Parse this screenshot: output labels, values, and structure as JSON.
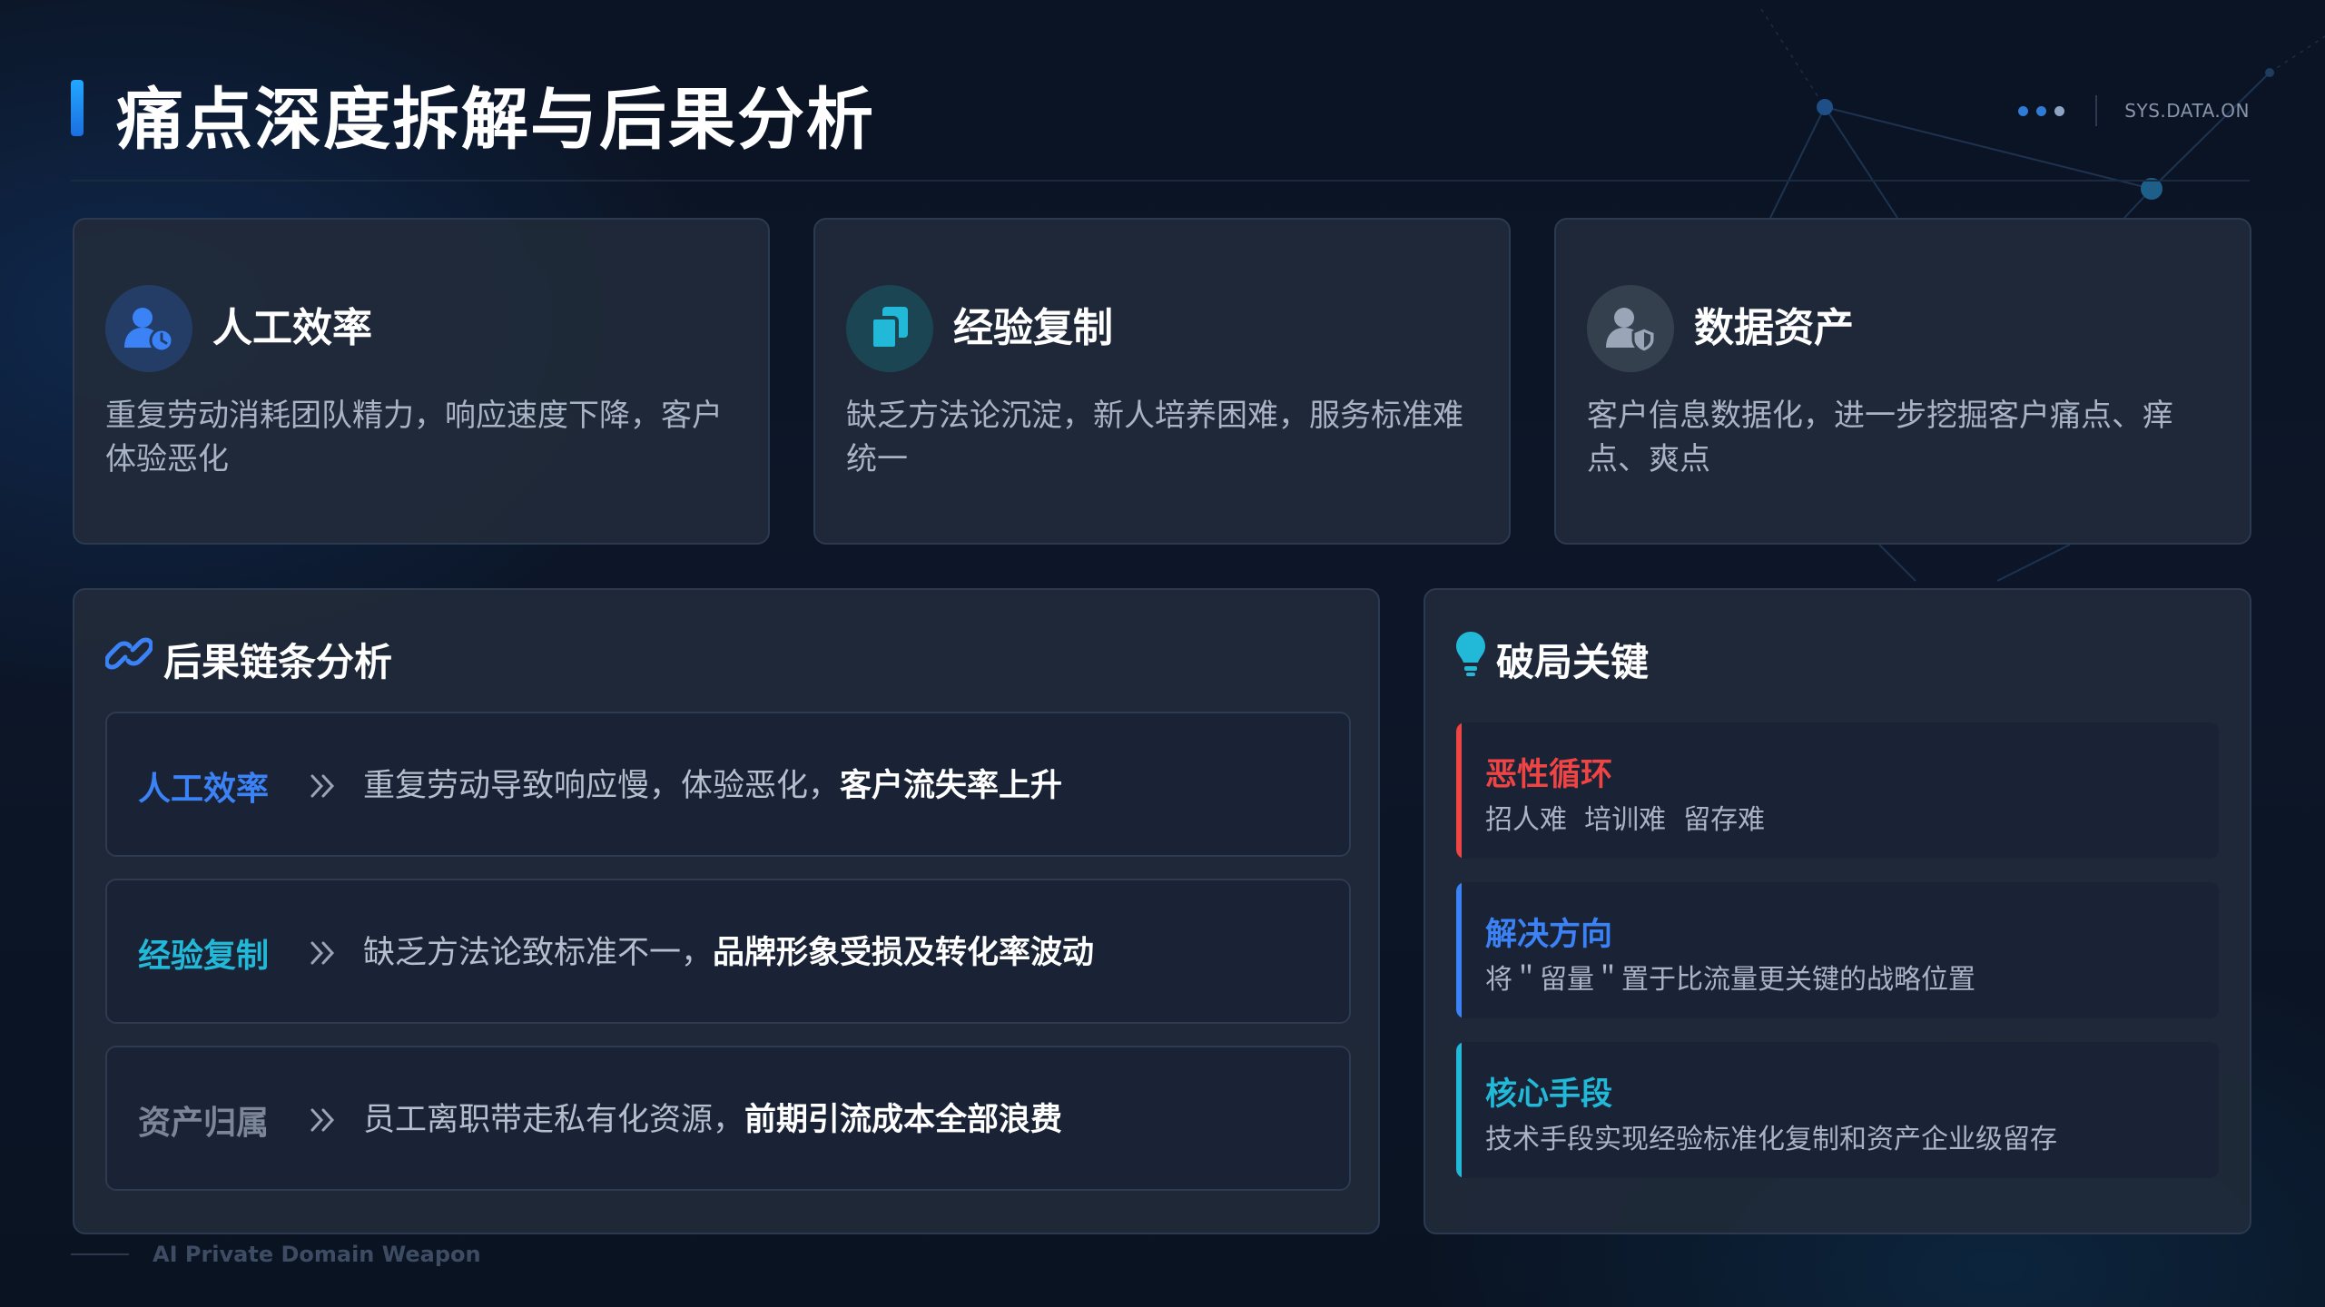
{
  "header": {
    "title": "痛点深度拆解与后果分析",
    "sys_label": "SYS.DATA.ON"
  },
  "pain_cards": [
    {
      "icon": "user-clock-icon",
      "title": "人工效率",
      "desc": "重复劳动消耗团队精力，响应速度下降，客户体验恶化",
      "accent": "#3b82f6"
    },
    {
      "icon": "copy-icon",
      "title": "经验复制",
      "desc": "缺乏方法论沉淀，新人培养困难，服务标准难统一",
      "accent": "#22b8d8"
    },
    {
      "icon": "user-shield-icon",
      "title": "数据资产",
      "desc": "客户信息数据化，进一步挖掘客户痛点、痒点、爽点",
      "accent": "#94a3b8"
    }
  ],
  "chain": {
    "title": "后果链条分析",
    "rows": [
      {
        "label": "人工效率",
        "label_color": "#3b82f6",
        "text": "重复劳动导致响应慢，体验恶化，",
        "emphasis": "客户流失率上升"
      },
      {
        "label": "经验复制",
        "label_color": "#22b8d8",
        "text": "缺乏方法论致标准不一，",
        "emphasis": "品牌形象受损及转化率波动"
      },
      {
        "label": "资产归属",
        "label_color": "#7b8698",
        "text": "员工离职带走私有化资源，",
        "emphasis": "前期引流成本全部浪费"
      }
    ]
  },
  "keys": {
    "title": "破局关键",
    "items": [
      {
        "title": "恶性循环",
        "desc": "招人难  培训难  留存难",
        "color": "#ef4444"
      },
      {
        "title": "解决方向",
        "desc": "将＂留量＂置于比流量更关键的战略位置",
        "color": "#3b82f6"
      },
      {
        "title": "核心手段",
        "desc": "技术手段实现经验标准化复制和资产企业级留存",
        "color": "#22b8d8"
      }
    ]
  },
  "footer": {
    "text": "AI Private Domain Weapon"
  }
}
